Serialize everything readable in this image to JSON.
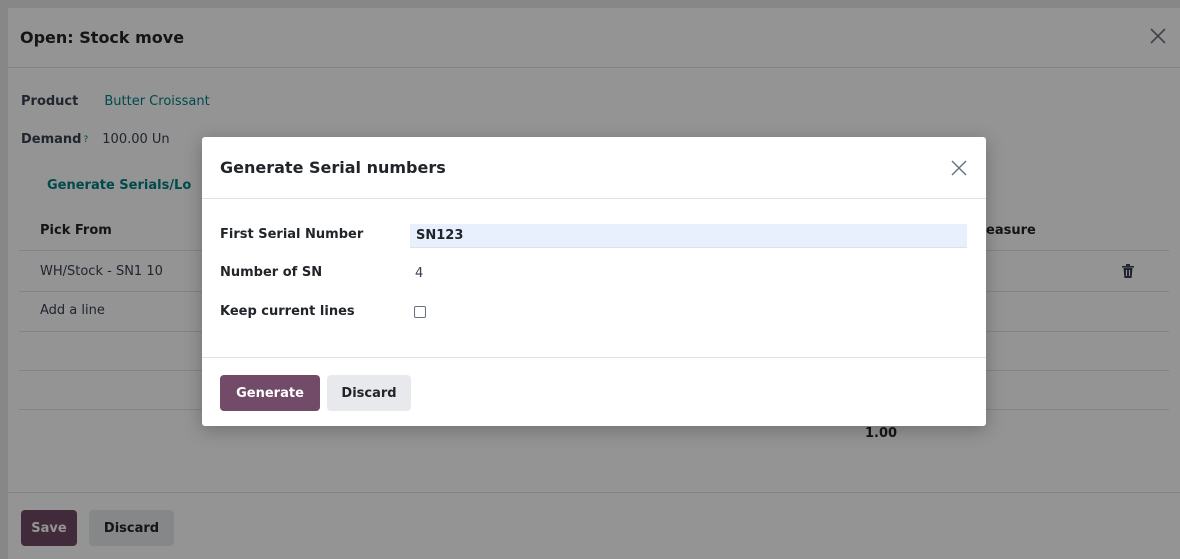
{
  "outer": {
    "title": "Open: Stock move",
    "product_label": "Product",
    "product_value": "Butter Croissant",
    "demand_label": "Demand",
    "demand_help": "?",
    "demand_value": "100.00 Un",
    "generate_lots_label": "Generate Serials/Lo",
    "table": {
      "col_pick_from": "Pick From",
      "col_uom": "easure",
      "row_pick_from": "WH/Stock - SN1 10",
      "add_line": "Add a line"
    },
    "total_value": "1.00",
    "save_label": "Save",
    "discard_label": "Discard"
  },
  "modal": {
    "title": "Generate Serial numbers",
    "first_serial_label": "First Serial Number",
    "first_serial_value": "SN123",
    "number_sn_label": "Number of SN",
    "number_sn_value": "4",
    "keep_lines_label": "Keep current lines",
    "keep_lines_checked": false,
    "generate_label": "Generate",
    "discard_label": "Discard"
  },
  "colors": {
    "primary": "#714b67",
    "link": "#017e84",
    "input_bg": "#e8f0fe"
  },
  "icons": {
    "close": "close-icon",
    "trash": "trash-icon"
  }
}
